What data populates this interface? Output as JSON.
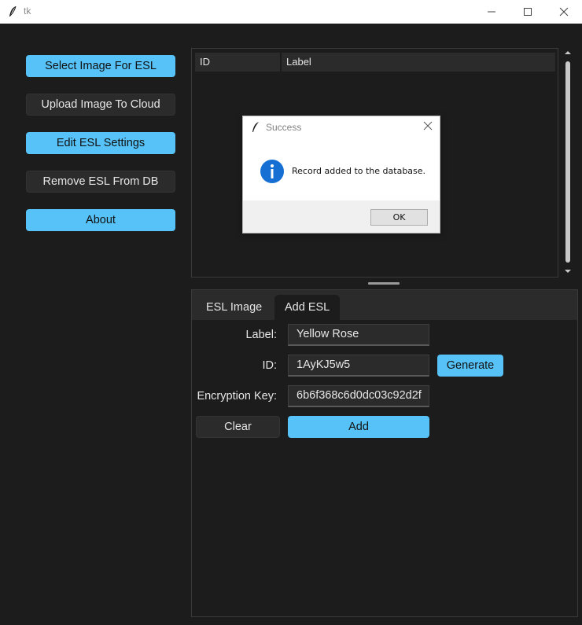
{
  "window": {
    "title": "tk"
  },
  "sidebar": {
    "buttons": [
      {
        "label": "Select Image For ESL",
        "style": "primary"
      },
      {
        "label": "Upload Image To Cloud",
        "style": "secondary"
      },
      {
        "label": "Edit ESL Settings",
        "style": "primary"
      },
      {
        "label": "Remove ESL From DB",
        "style": "secondary"
      },
      {
        "label": "About",
        "style": "primary"
      }
    ]
  },
  "table": {
    "columns": [
      "ID",
      "Label"
    ],
    "rows": []
  },
  "tabs": [
    {
      "label": "ESL Image",
      "active": false
    },
    {
      "label": "Add ESL",
      "active": true
    }
  ],
  "form": {
    "label_field": {
      "label": "Label:",
      "value": "Yellow Rose"
    },
    "id_field": {
      "label": "ID:",
      "value": "1AyKJ5w5"
    },
    "key_field": {
      "label": "Encryption Key:",
      "value": "6b6f368c6d0dc03c92d2f"
    },
    "generate_label": "Generate",
    "clear_label": "Clear",
    "add_label": "Add"
  },
  "dialog": {
    "title": "Success",
    "message": "Record added to the database.",
    "ok_label": "OK",
    "icon": "info-icon"
  },
  "colors": {
    "accent": "#56c2f7",
    "background": "#1c1c1c",
    "surface": "#2b2b2b"
  }
}
